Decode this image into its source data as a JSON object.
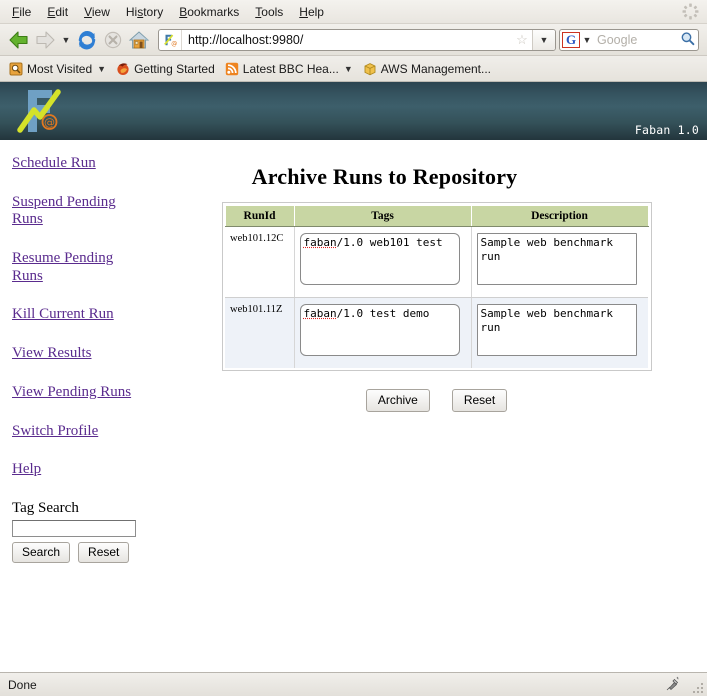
{
  "browser": {
    "menu": [
      {
        "label": "File",
        "mnemonic": "F"
      },
      {
        "label": "Edit",
        "mnemonic": "E"
      },
      {
        "label": "View",
        "mnemonic": "V"
      },
      {
        "label": "History",
        "mnemonic": "s"
      },
      {
        "label": "Bookmarks",
        "mnemonic": "B"
      },
      {
        "label": "Tools",
        "mnemonic": "T"
      },
      {
        "label": "Help",
        "mnemonic": "H"
      }
    ],
    "nav": {
      "back": "back-arrow",
      "forward": "forward-arrow",
      "history_dropdown": "chevron-down-icon",
      "reload": "reload-icon",
      "stop": "stop-icon",
      "home": "home-icon"
    },
    "url": "http://localhost:9980/",
    "url_favicon": "faban-favicon",
    "bookmark_star": "star-icon",
    "url_dropdown": "chevron-down-icon",
    "search": {
      "engine": "G",
      "placeholder": "Google",
      "value": "",
      "magnifier": "search-icon"
    },
    "bookmarks": [
      {
        "label": "Most Visited",
        "icon": "most-visited-icon",
        "has_caret": true
      },
      {
        "label": "Getting Started",
        "icon": "firefox-icon",
        "has_caret": false
      },
      {
        "label": "Latest BBC Hea...",
        "icon": "rss-feed-icon",
        "has_caret": true
      },
      {
        "label": "AWS Management...",
        "icon": "aws-box-icon",
        "has_caret": false
      }
    ],
    "status": "Done",
    "throbber": "throbber-idle-icon"
  },
  "app": {
    "banner_version": "Faban 1.0",
    "logo": "faban-logo"
  },
  "page": {
    "title": "Archive Runs to Repository"
  },
  "sidebar": {
    "links": [
      "Schedule Run",
      "Suspend Pending Runs",
      "Resume Pending Runs",
      "Kill Current Run",
      "View Results",
      "View Pending Runs",
      "Switch Profile",
      "Help"
    ],
    "tag_search": {
      "label": "Tag Search",
      "value": "",
      "placeholder": "",
      "search_button": "Search",
      "reset_button": "Reset"
    }
  },
  "table": {
    "headers": [
      "RunId",
      "Tags",
      "Description"
    ],
    "rows": [
      {
        "runid": "web101.12C",
        "tags": "faban/1.0 web101 test",
        "tags_spell_word": "faban",
        "tags_rest": "/1.0 web101 test",
        "description": "Sample web benchmark run"
      },
      {
        "runid": "web101.11Z",
        "tags": "faban/1.0 test demo",
        "tags_spell_word": "faban",
        "tags_rest": "/1.0 test demo",
        "description": "Sample web benchmark run"
      }
    ]
  },
  "actions": {
    "archive_button": "Archive",
    "reset_button": "Reset"
  },
  "colors": {
    "link": "#5a2b8e",
    "table_header_bg": "#c8d6a3",
    "row_alt_bg": "#eef2f8",
    "banner_top": "#2c4450",
    "banner_bottom": "#23353c"
  }
}
